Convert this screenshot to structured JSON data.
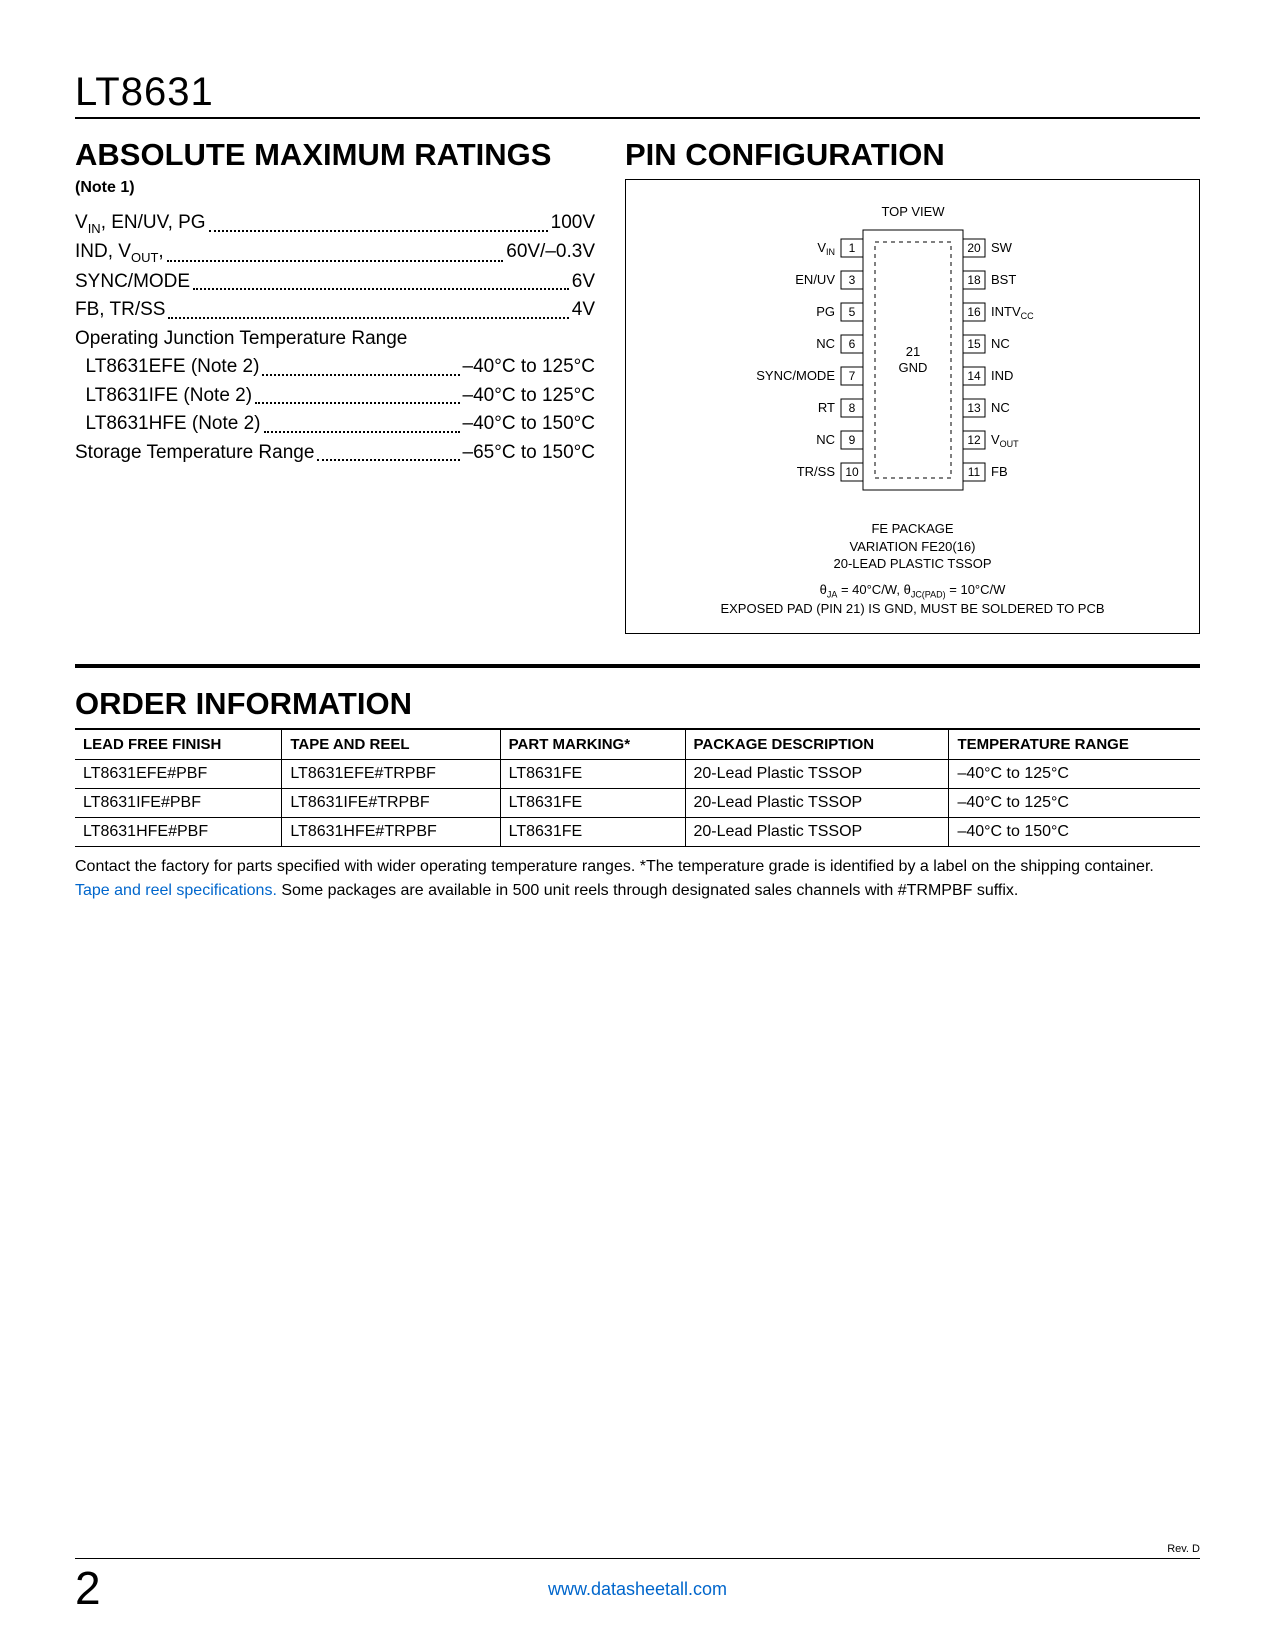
{
  "part_number": "LT8631",
  "sections": {
    "abs_max": {
      "title": "ABSOLUTE MAXIMUM RATINGS",
      "note": "(Note 1)",
      "lines": [
        {
          "label_html": "V<sub>IN</sub>, EN/UV, PG",
          "value": "100V"
        },
        {
          "label_html": "IND, V<sub>OUT</sub>,",
          "value": "60V/–0.3V"
        },
        {
          "label_html": "SYNC/MODE",
          "value": "6V"
        },
        {
          "label_html": "FB, TR/SS",
          "value": "4V"
        },
        {
          "label_html": "Operating Junction Temperature Range",
          "value": ""
        },
        {
          "label_html": "&nbsp;&nbsp;LT8631EFE (Note 2)",
          "value": "–40°C to 125°C"
        },
        {
          "label_html": "&nbsp;&nbsp;LT8631IFE (Note 2)",
          "value": "–40°C to 125°C"
        },
        {
          "label_html": "&nbsp;&nbsp;LT8631HFE (Note 2)",
          "value": "–40°C to 150°C"
        },
        {
          "label_html": "Storage Temperature Range",
          "value": "–65°C to 150°C"
        }
      ]
    },
    "pin_config": {
      "title": "PIN CONFIGURATION",
      "top_view": "TOP VIEW",
      "center_pin": "21",
      "center_label": "GND",
      "left_pins": [
        {
          "num": "1",
          "name": "VIN",
          "sub": "IN"
        },
        {
          "num": "3",
          "name": "EN/UV"
        },
        {
          "num": "5",
          "name": "PG"
        },
        {
          "num": "6",
          "name": "NC"
        },
        {
          "num": "7",
          "name": "SYNC/MODE"
        },
        {
          "num": "8",
          "name": "RT"
        },
        {
          "num": "9",
          "name": "NC"
        },
        {
          "num": "10",
          "name": "TR/SS"
        }
      ],
      "right_pins": [
        {
          "num": "20",
          "name": "SW"
        },
        {
          "num": "18",
          "name": "BST"
        },
        {
          "num": "16",
          "name": "INTVCC",
          "sub": "CC"
        },
        {
          "num": "15",
          "name": "NC"
        },
        {
          "num": "14",
          "name": "IND"
        },
        {
          "num": "13",
          "name": "NC"
        },
        {
          "num": "12",
          "name": "VOUT",
          "sub": "OUT"
        },
        {
          "num": "11",
          "name": "FB"
        }
      ],
      "package_lines": [
        "FE PACKAGE",
        "VARIATION FE20(16)",
        "20-LEAD PLASTIC TSSOP"
      ],
      "thermal_line": "θJA = 40°C/W, θJC(PAD) = 10°C/W",
      "exposed_line": "EXPOSED PAD (PIN 21) IS GND, MUST BE SOLDERED TO PCB"
    },
    "order": {
      "title": "ORDER INFORMATION",
      "headers": [
        "LEAD FREE FINISH",
        "TAPE AND REEL",
        "PART MARKING*",
        "PACKAGE DESCRIPTION",
        "TEMPERATURE RANGE"
      ],
      "rows": [
        [
          "LT8631EFE#PBF",
          "LT8631EFE#TRPBF",
          "LT8631FE",
          "20-Lead Plastic TSSOP",
          "–40°C to 125°C"
        ],
        [
          "LT8631IFE#PBF",
          "LT8631IFE#TRPBF",
          "LT8631FE",
          "20-Lead Plastic TSSOP",
          "–40°C to 125°C"
        ],
        [
          "LT8631HFE#PBF",
          "LT8631HFE#TRPBF",
          "LT8631FE",
          "20-Lead Plastic TSSOP",
          "–40°C to 150°C"
        ]
      ],
      "footnote_plain1": "Contact the factory for parts specified with wider operating temperature ranges. *The temperature grade is identified by a label on the shipping container.",
      "footnote_link": "Tape and reel specifications.",
      "footnote_plain2": " Some packages are available in 500 unit reels through designated sales channels with #TRMPBF suffix."
    }
  },
  "footer": {
    "page": "2",
    "link": "www.datasheetall.com",
    "rev": "Rev. D"
  }
}
